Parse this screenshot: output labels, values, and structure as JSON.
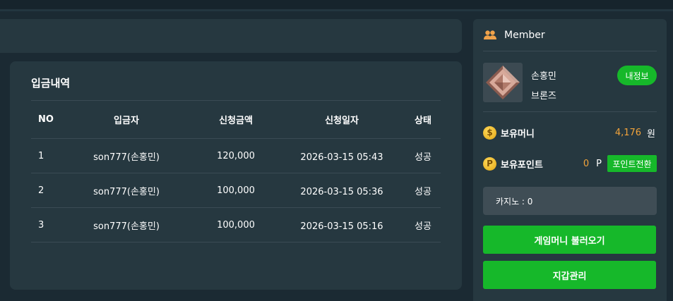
{
  "deposit": {
    "title": "입금내역",
    "headers": {
      "no": "NO",
      "depositor": "입금자",
      "amount": "신청금액",
      "date": "신청일자",
      "status": "상태"
    },
    "rows": [
      {
        "no": "1",
        "depositor": "son777(손홍민)",
        "amount": "120,000",
        "date": "2026-03-15 05:43",
        "status": "성공"
      },
      {
        "no": "2",
        "depositor": "son777(손홍민)",
        "amount": "100,000",
        "date": "2026-03-15 05:36",
        "status": "성공"
      },
      {
        "no": "3",
        "depositor": "son777(손홍민)",
        "amount": "100,000",
        "date": "2026-03-15 05:16",
        "status": "성공"
      }
    ]
  },
  "member": {
    "header": "Member",
    "header_icon": "users-icon",
    "name": "손홍민",
    "grade": "브론즈",
    "grade_icon": "bronze-rank-diamond",
    "info_button": "내정보",
    "money_label": "보유머니",
    "money_icon_symbol": "$",
    "money_value": "4,176",
    "money_unit": "원",
    "point_label": "보유포인트",
    "point_icon_symbol": "P",
    "point_value": "0",
    "point_unit": "P",
    "convert_button": "포인트전환",
    "casino_label": "카지노 : 0",
    "load_game_money_button": "게임머니 불러오기",
    "wallet_button": "지갑관리"
  },
  "colors": {
    "background": "#1b2a33",
    "panel": "#263840",
    "accent_green": "#16b82a",
    "amount_orange": "#f2a33a",
    "coin_gold": "#e2a513"
  }
}
